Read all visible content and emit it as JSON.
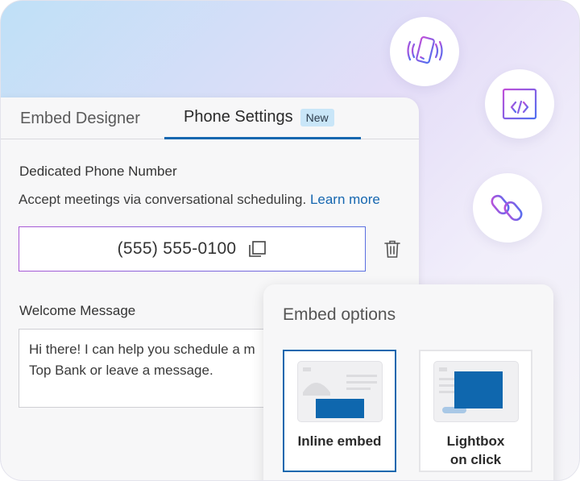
{
  "tabs": [
    {
      "label": "Embed Designer"
    },
    {
      "label": "Phone Settings",
      "badge": "New"
    }
  ],
  "phone_section": {
    "title": "Dedicated Phone Number",
    "description": "Accept meetings via conversational scheduling.",
    "learn_more": "Learn more",
    "number": "(555) 555-0100"
  },
  "welcome_section": {
    "title": "Welcome Message",
    "message_line1": "Hi there! I can help you schedule a m",
    "message_line2": "Top Bank or leave a message."
  },
  "embed_options": {
    "title": "Embed options",
    "options": [
      {
        "label": "Inline embed",
        "selected": true
      },
      {
        "label_line1": "Lightbox",
        "label_line2": "on click",
        "selected": false
      }
    ]
  },
  "colors": {
    "accent": "#1667b0",
    "badge_bg": "#c9e6f8",
    "icon_gradient_start": "#c04fd8",
    "icon_gradient_end": "#4f6ff0"
  },
  "icons": [
    "phone-vibrate-icon",
    "code-window-icon",
    "link-icon",
    "copy-icon",
    "trash-icon"
  ]
}
